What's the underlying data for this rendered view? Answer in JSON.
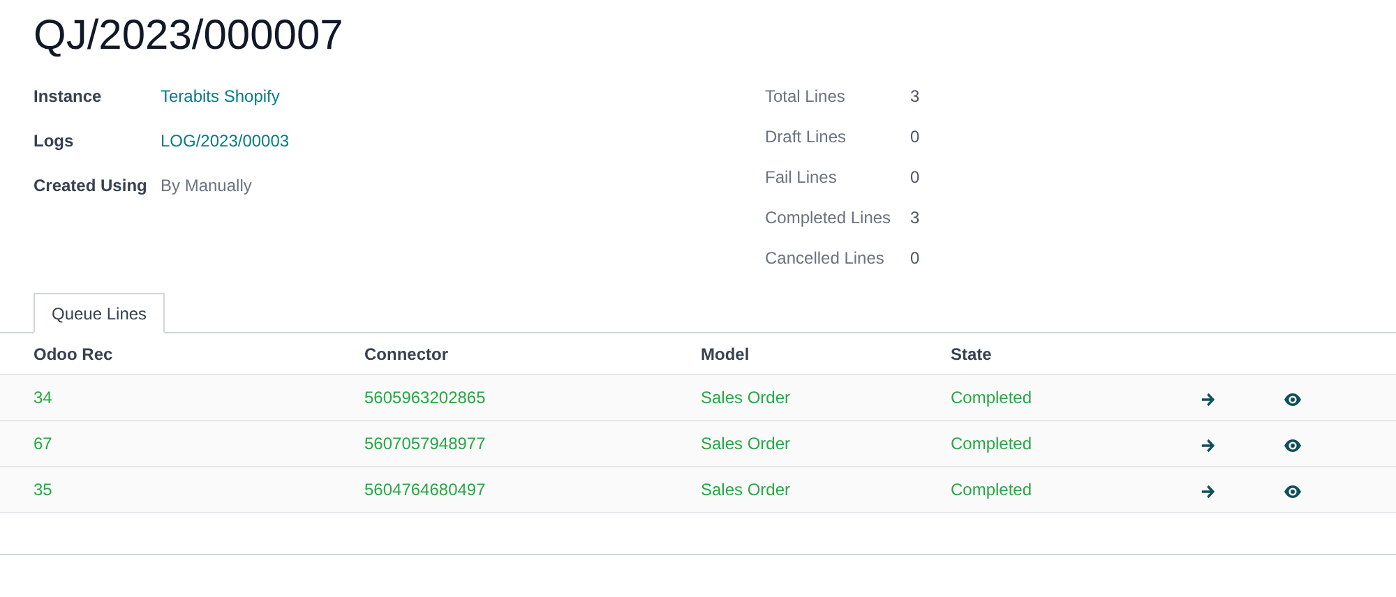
{
  "title": "QJ/2023/000007",
  "fields": [
    {
      "label": "Instance",
      "value": "Terabits Shopify",
      "kind": "link"
    },
    {
      "label": "Logs",
      "value": "LOG/2023/00003",
      "kind": "link"
    },
    {
      "label": "Created Using",
      "value": "By Manually",
      "kind": "text"
    }
  ],
  "stats": [
    {
      "label": "Total Lines",
      "value": "3"
    },
    {
      "label": "Draft Lines",
      "value": "0"
    },
    {
      "label": "Fail Lines",
      "value": "0"
    },
    {
      "label": "Completed Lines",
      "value": "3"
    },
    {
      "label": "Cancelled Lines",
      "value": "0"
    }
  ],
  "tabs": [
    {
      "label": "Queue Lines",
      "selected": true
    }
  ],
  "table": {
    "columns": [
      "Odoo Rec",
      "Connector",
      "Model",
      "State"
    ],
    "rows": [
      {
        "cells": [
          "34",
          "5605963202865",
          "Sales Order",
          "Completed"
        ]
      },
      {
        "cells": [
          "67",
          "5607057948977",
          "Sales Order",
          "Completed"
        ]
      },
      {
        "cells": [
          "35",
          "5604764680497",
          "Sales Order",
          "Completed"
        ]
      }
    ]
  }
}
